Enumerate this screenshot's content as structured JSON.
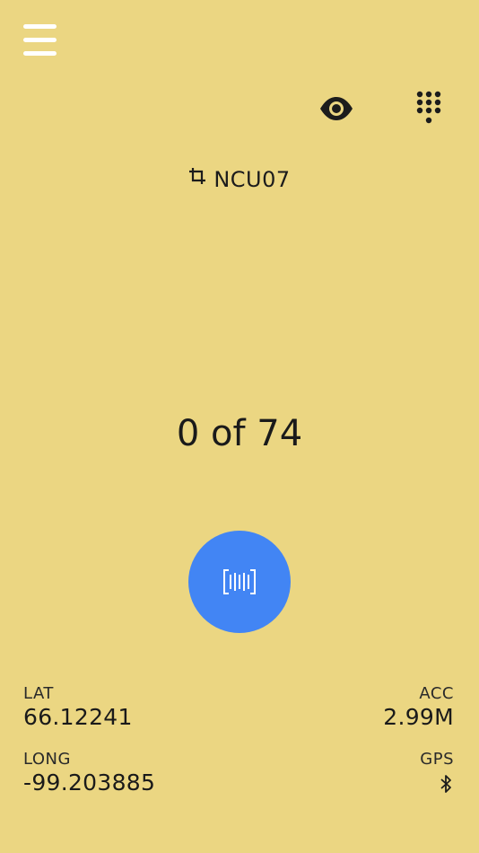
{
  "header": {
    "menu_icon": "hamburger-menu-icon",
    "visibility_icon": "eye-icon",
    "keypad_icon": "dialpad-icon"
  },
  "site": {
    "icon": "crop-icon",
    "code": "NCU07"
  },
  "progress": {
    "text": "0 of 74",
    "scanned": 0,
    "total": 74
  },
  "scan_button": {
    "icon": "barcode-scan-icon",
    "color": "#4285f4"
  },
  "location": {
    "lat_label": "LAT",
    "lat_value": "66.12241",
    "long_label": "LONG",
    "long_value": "-99.203885",
    "acc_label": "ACC",
    "acc_value": "2.99M",
    "gps_label": "GPS",
    "gps_icon": "bluetooth-icon"
  },
  "colors": {
    "background": "#ebd682",
    "accent": "#4285f4"
  }
}
